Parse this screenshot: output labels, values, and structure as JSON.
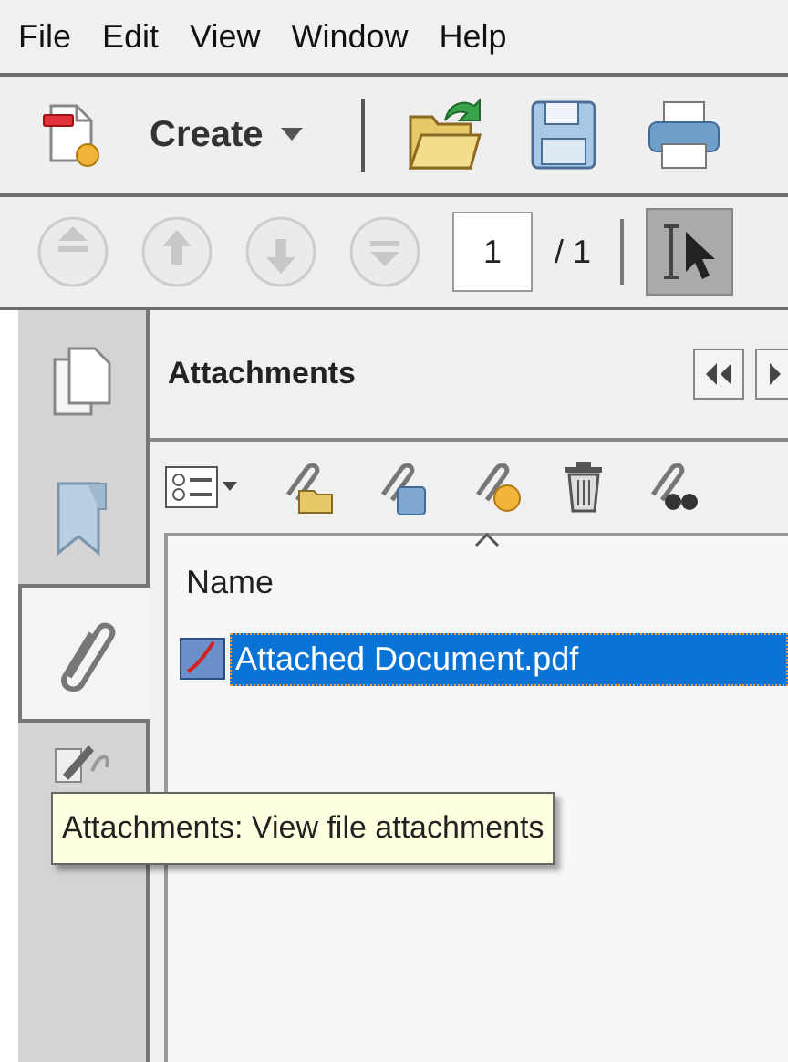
{
  "menu": [
    "File",
    "Edit",
    "View",
    "Window",
    "Help"
  ],
  "toolbar": {
    "create_label": "Create"
  },
  "page_nav": {
    "page": "1",
    "total": "/ 1"
  },
  "side_tabs": [
    {
      "kind": "pages",
      "selected": false
    },
    {
      "kind": "bookmarks",
      "selected": false
    },
    {
      "kind": "attachments",
      "selected": true
    },
    {
      "kind": "signatures",
      "selected": false
    }
  ],
  "panel": {
    "title": "Attachments",
    "column": "Name",
    "rows": [
      {
        "name": "Attached Document.pdf",
        "selected": true
      }
    ]
  },
  "tooltip": {
    "text": "Attachments: View file attachments"
  }
}
